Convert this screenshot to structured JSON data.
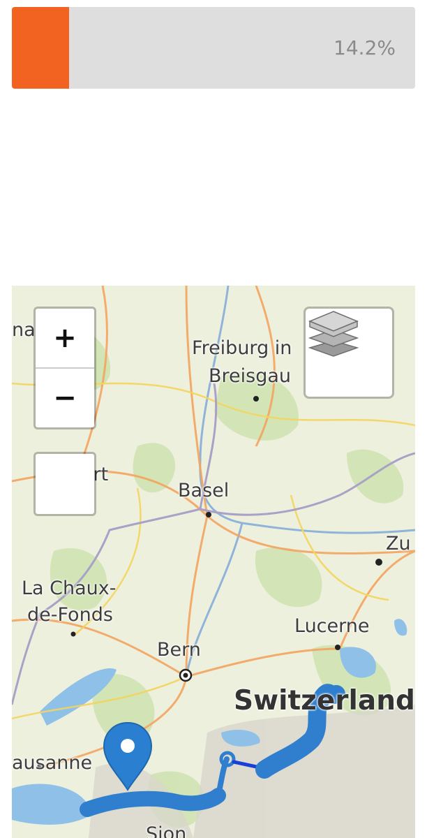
{
  "progress": {
    "value": 0.142,
    "label": "14.2%",
    "fill_color": "#f26322"
  },
  "map": {
    "labels": {
      "freiburg_1": "Freiburg in",
      "freiburg_2": "Breisgau",
      "basel": "Basel",
      "chaux_1": "La Chaux-",
      "chaux_2": "de-Fonds",
      "bern": "Bern",
      "lucerne": "Lucerne",
      "switzerland": "Switzerland",
      "lausanne": "ausanne",
      "zurich": "Zu",
      "sion": "Sion",
      "nal": "nal",
      "ort": "ort"
    },
    "controls": {
      "zoom_in": "+",
      "zoom_out": "−",
      "layers_icon": "layers-icon"
    },
    "route_color": "#2f7fce",
    "marker_color": "#2b7fd0"
  }
}
